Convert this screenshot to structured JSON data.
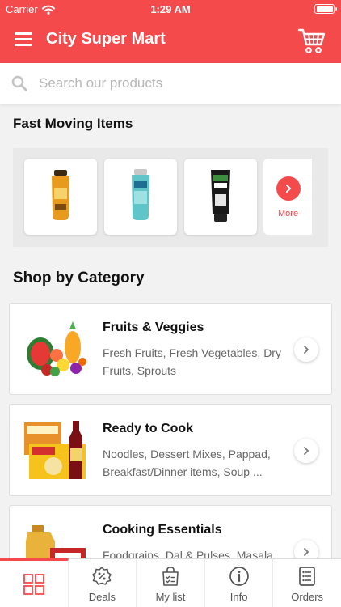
{
  "status": {
    "carrier": "Carrier",
    "time": "1:29 AM"
  },
  "header": {
    "title": "City Super Mart"
  },
  "search": {
    "placeholder": "Search our products"
  },
  "fast_moving": {
    "title": "Fast Moving Items",
    "items": [
      {
        "icon": "conditioner-bottle-gold"
      },
      {
        "icon": "conditioner-bottle-teal"
      },
      {
        "icon": "face-wash-tube"
      }
    ],
    "more_label": "More"
  },
  "categories": {
    "title": "Shop by Category",
    "items": [
      {
        "name": "Fruits & Veggies",
        "description": "Fresh Fruits, Fresh Vegetables, Dry Fruits, Sprouts",
        "icon": "fruits-veggies-image"
      },
      {
        "name": "Ready to Cook",
        "description": "Noodles, Dessert Mixes, Pappad, Breakfast/Dinner items, Soup ...",
        "icon": "ready-to-cook-image"
      },
      {
        "name": "Cooking Essentials",
        "description": "Foodgrains, Dal & Pulses, Masala",
        "icon": "cooking-essentials-image"
      }
    ]
  },
  "tabs": [
    {
      "label": "",
      "icon": "grid-icon",
      "active": true
    },
    {
      "label": "Deals",
      "icon": "deals-badge-icon"
    },
    {
      "label": "My list",
      "icon": "list-bag-icon"
    },
    {
      "label": "Info",
      "icon": "info-icon"
    },
    {
      "label": "Orders",
      "icon": "orders-icon"
    }
  ],
  "colors": {
    "brand": "#f54a4c",
    "background": "#f2f2f2"
  }
}
